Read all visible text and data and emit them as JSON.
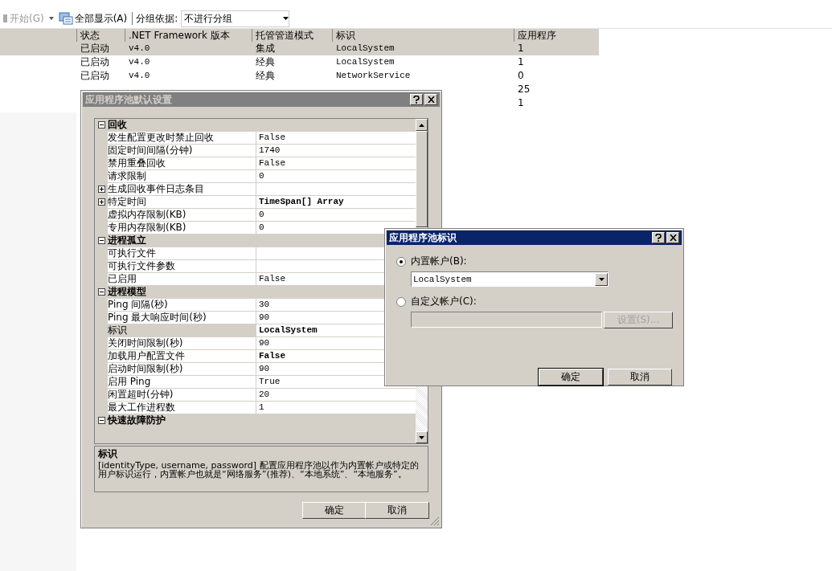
{
  "toolbar": {
    "start": {
      "label": "开始(G)",
      "disabled": true
    },
    "show_all": "全部显示(A)",
    "group_label": "分组依据:",
    "group_value": "不进行分组"
  },
  "table": {
    "columns": [
      "状态",
      ".NET Framework 版本",
      "托管管道模式",
      "标识",
      "应用程序"
    ],
    "rows": [
      {
        "selected": true,
        "status": "已启动",
        "version": "v4.0",
        "mode": "集成",
        "identity": "LocalSystem",
        "apps": "1"
      },
      {
        "selected": false,
        "status": "已启动",
        "version": "v4.0",
        "mode": "经典",
        "identity": "LocalSystem",
        "apps": "1"
      },
      {
        "selected": false,
        "status": "已启动",
        "version": "v4.0",
        "mode": "经典",
        "identity": "NetworkService",
        "apps": "0"
      },
      {
        "selected": false,
        "apps": "25"
      },
      {
        "selected": false,
        "apps": "1"
      }
    ]
  },
  "defaults_dialog": {
    "title": "应用程序池默认设置",
    "active": false,
    "categories": [
      {
        "name": "回收",
        "expanded": true,
        "properties": [
          {
            "name": "发生配置更改时禁止回收",
            "value": "False",
            "bold": false,
            "selected": false
          },
          {
            "name": "固定时间间隔(分钟)",
            "value": "1740",
            "bold": false,
            "selected": false
          },
          {
            "name": "禁用重叠回收",
            "value": "False",
            "bold": false,
            "selected": false
          },
          {
            "name": "请求限制",
            "value": "0",
            "bold": false,
            "selected": false
          },
          {
            "name": "生成回收事件日志条目",
            "selected": false,
            "expanded": false
          },
          {
            "name": "特定时间",
            "value": "TimeSpan[] Array",
            "bold": true,
            "selected": false,
            "expanded": false
          },
          {
            "name": "虚拟内存限制(KB)",
            "value": "0",
            "bold": false,
            "selected": false
          },
          {
            "name": "专用内存限制(KB)",
            "value": "0",
            "bold": false,
            "selected": false
          }
        ]
      },
      {
        "name": "进程孤立",
        "expanded": true,
        "properties": [
          {
            "name": "可执行文件",
            "selected": false
          },
          {
            "name": "可执行文件参数",
            "selected": false
          },
          {
            "name": "已启用",
            "value": "False",
            "bold": false,
            "selected": false
          }
        ]
      },
      {
        "name": "进程模型",
        "expanded": true,
        "properties": [
          {
            "name": "Ping 间隔(秒)",
            "value": "30",
            "bold": false,
            "selected": false
          },
          {
            "name": "Ping 最大响应时间(秒)",
            "value": "90",
            "bold": false,
            "selected": false
          },
          {
            "name": "标识",
            "value": "LocalSystem",
            "bold": true,
            "selected": true
          },
          {
            "name": "关闭时间限制(秒)",
            "value": "90",
            "bold": false,
            "selected": false
          },
          {
            "name": "加载用户配置文件",
            "value": "False",
            "bold": true,
            "selected": false
          },
          {
            "name": "启动时间限制(秒)",
            "value": "90",
            "bold": false,
            "selected": false
          },
          {
            "name": "启用 Ping",
            "value": "True",
            "bold": false,
            "selected": false
          },
          {
            "name": "闲置超时(分钟)",
            "value": "20",
            "bold": false,
            "selected": false
          },
          {
            "name": "最大工作进程数",
            "value": "1",
            "bold": false,
            "selected": false
          }
        ]
      },
      {
        "name": "快速故障防护",
        "expanded": true
      }
    ],
    "description": {
      "title": "标识",
      "text": "[identityType, username, password] 配置应用程序池以作为内置帐户或特定的用户标识运行，内置帐户也就是“网络服务”(推荐)、“本地系统”、“本地服务”。"
    },
    "buttons": [
      "确定",
      "取消"
    ]
  },
  "identity_dialog": {
    "title": "应用程序池标识",
    "active": true,
    "options": [
      {
        "label": "内置帐户(B):",
        "selected": true
      },
      {
        "label": "自定义帐户(C):",
        "selected": false
      }
    ],
    "builtin_value": "LocalSystem",
    "set_button": {
      "label": "设置(S)...",
      "disabled": true
    },
    "buttons": [
      "确定",
      "取消"
    ]
  }
}
